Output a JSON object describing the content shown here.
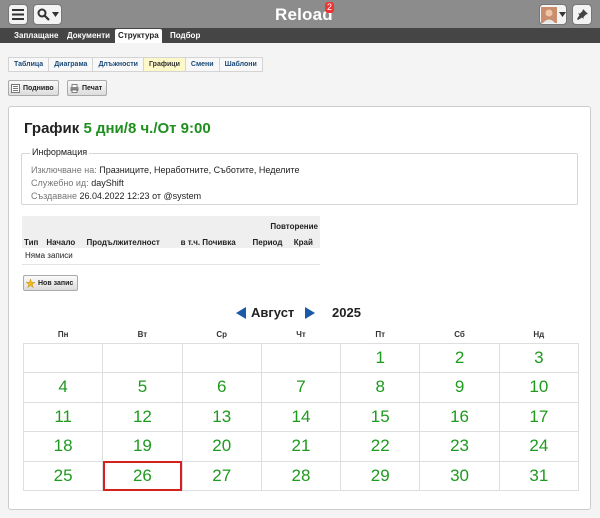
{
  "app": {
    "title": "Reload",
    "notification_count": "2"
  },
  "main_tabs": [
    "Заплащане",
    "Документи",
    "Структура",
    "Подбор"
  ],
  "sub_tabs": [
    "Таблица",
    "Диаграма",
    "Длъжности",
    "Графици",
    "Смени",
    "Шаблони"
  ],
  "actions": {
    "up": "Подниво",
    "print": "Печат"
  },
  "schedule": {
    "label": "График",
    "name": "5 дни/8 ч./От 9:00"
  },
  "info": {
    "legend": "Информация",
    "excluded_label": "Изключване на:",
    "excluded_value": "Празниците, Неработните, Съботите, Неделите",
    "service_label": "Служебно ид:",
    "service_value": "dayShift",
    "created_label": "Създаване",
    "created_value": "26.04.2022 12:23 от @system"
  },
  "sub_table": {
    "headers": [
      "Тип",
      "Начало",
      "Продължителност",
      "в т.ч. Почивка",
      "Повторение"
    ],
    "repeat_sub": [
      "Период",
      "Край"
    ],
    "empty_text": "Няма записи"
  },
  "new_record": "Нов запис",
  "calendar": {
    "month": "Август",
    "year": "2025",
    "weekdays": [
      "Пн",
      "Вт",
      "Ср",
      "Чт",
      "Пт",
      "Сб",
      "Нд"
    ],
    "weeks": [
      [
        "",
        "",
        "",
        "",
        "1",
        "2",
        "3"
      ],
      [
        "4",
        "5",
        "6",
        "7",
        "8",
        "9",
        "10"
      ],
      [
        "11",
        "12",
        "13",
        "14",
        "15",
        "16",
        "17"
      ],
      [
        "18",
        "19",
        "20",
        "21",
        "22",
        "23",
        "24"
      ],
      [
        "25",
        "26",
        "27",
        "28",
        "29",
        "30",
        "31"
      ]
    ],
    "today": "26",
    "day_color": "#1e9a1e",
    "today_border": "#d52020"
  },
  "icons": [
    "menu-icon",
    "search-icon",
    "chevron-down-icon",
    "avatar",
    "pin-icon",
    "up-level-icon",
    "printer-icon",
    "star-icon",
    "arrow-left-icon",
    "arrow-right-icon"
  ]
}
